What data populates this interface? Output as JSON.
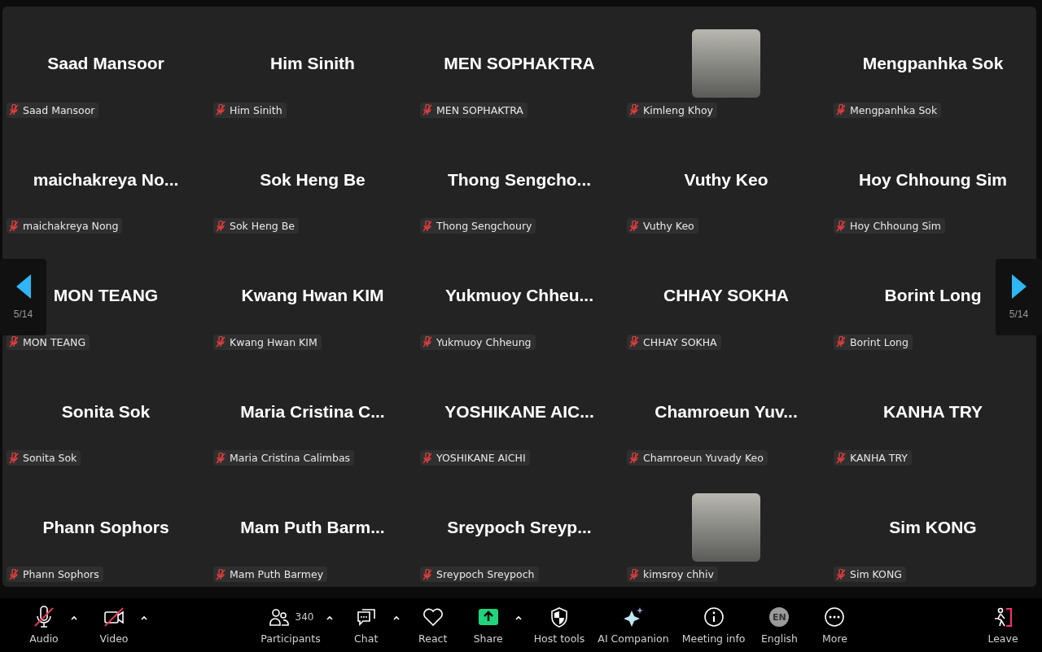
{
  "tiles": [
    {
      "kind": "name",
      "display": "Saad Mansoor",
      "label": "Saad Mansoor",
      "muted": true
    },
    {
      "kind": "name",
      "display": "Him Sinith",
      "label": "Him Sinith",
      "muted": true
    },
    {
      "kind": "name",
      "display": "MEN SOPHAKTRA",
      "label": "MEN SOPHAKTRA",
      "muted": true
    },
    {
      "kind": "photo",
      "label": "Kimleng Khoy",
      "muted": true
    },
    {
      "kind": "name",
      "display": "Mengpanhka Sok",
      "label": "Mengpanhka Sok",
      "muted": true
    },
    {
      "kind": "name",
      "display": "maichakreya  No...",
      "label": "maichakreya Nong",
      "muted": true
    },
    {
      "kind": "name",
      "display": "Sok Heng Be",
      "label": "Sok Heng Be",
      "muted": true
    },
    {
      "kind": "name",
      "display": "Thong  Sengcho...",
      "label": "Thong Sengchoury",
      "muted": true
    },
    {
      "kind": "name",
      "display": "Vuthy Keo",
      "label": "Vuthy Keo",
      "muted": true
    },
    {
      "kind": "name",
      "display": "Hoy Chhoung Sim",
      "label": "Hoy Chhoung Sim",
      "muted": true
    },
    {
      "kind": "name",
      "display": "MON TEANG",
      "label": "MON TEANG",
      "muted": true
    },
    {
      "kind": "name",
      "display": "Kwang Hwan KIM",
      "label": "Kwang Hwan KIM",
      "muted": true
    },
    {
      "kind": "name",
      "display": "Yukmuoy  Chheu...",
      "label": "Yukmuoy Chheung",
      "muted": true
    },
    {
      "kind": "name",
      "display": "CHHAY SOKHA",
      "label": "CHHAY SOKHA",
      "muted": true
    },
    {
      "kind": "name",
      "display": "Borint Long",
      "label": "Borint Long",
      "muted": true
    },
    {
      "kind": "name",
      "display": "Sonita Sok",
      "label": "Sonita Sok",
      "muted": true
    },
    {
      "kind": "name",
      "display": "Maria  Cristina  C...",
      "label": "Maria Cristina Calimbas",
      "muted": true
    },
    {
      "kind": "name",
      "display": "YOSHIKANE  AIC...",
      "label": "YOSHIKANE AICHI",
      "muted": true
    },
    {
      "kind": "name",
      "display": "Chamroeun  Yuv...",
      "label": "Chamroeun Yuvady Keo",
      "muted": true
    },
    {
      "kind": "name",
      "display": "KANHA TRY",
      "label": "KANHA TRY",
      "muted": true
    },
    {
      "kind": "name",
      "display": "Phann Sophors",
      "label": "Phann Sophors",
      "muted": true
    },
    {
      "kind": "name",
      "display": "Mam  Puth  Barm...",
      "label": "Mam Puth Barmey",
      "muted": true
    },
    {
      "kind": "name",
      "display": "Sreypoch  Sreyp...",
      "label": "Sreypoch Sreypoch",
      "muted": true
    },
    {
      "kind": "photo",
      "label": "kimsroy chhiv",
      "muted": true
    },
    {
      "kind": "name",
      "display": "Sim KONG",
      "label": "Sim KONG",
      "muted": true
    }
  ],
  "pager": {
    "previous": "5/14",
    "next": "5/14"
  },
  "toolbar": {
    "left": [
      {
        "kind": "audio",
        "label": "Audio",
        "caret": true,
        "muted": true
      },
      {
        "kind": "video",
        "label": "Video",
        "caret": true,
        "muted": true
      }
    ],
    "center": [
      {
        "kind": "participants",
        "label": "Participants",
        "count": "340",
        "caret": true
      },
      {
        "kind": "chat",
        "label": "Chat",
        "caret": true
      },
      {
        "kind": "react",
        "label": "React",
        "caret": false
      },
      {
        "kind": "share",
        "label": "Share",
        "caret": true
      },
      {
        "kind": "host",
        "label": "Host tools",
        "caret": false
      },
      {
        "kind": "ai",
        "label": "AI Companion",
        "caret": false
      },
      {
        "kind": "info",
        "label": "Meeting info",
        "caret": false
      },
      {
        "kind": "language",
        "label": "English",
        "badge": "EN",
        "caret": false
      },
      {
        "kind": "more",
        "label": "More",
        "caret": false
      }
    ],
    "right": [
      {
        "kind": "leave",
        "label": "Leave",
        "caret": false
      }
    ]
  }
}
